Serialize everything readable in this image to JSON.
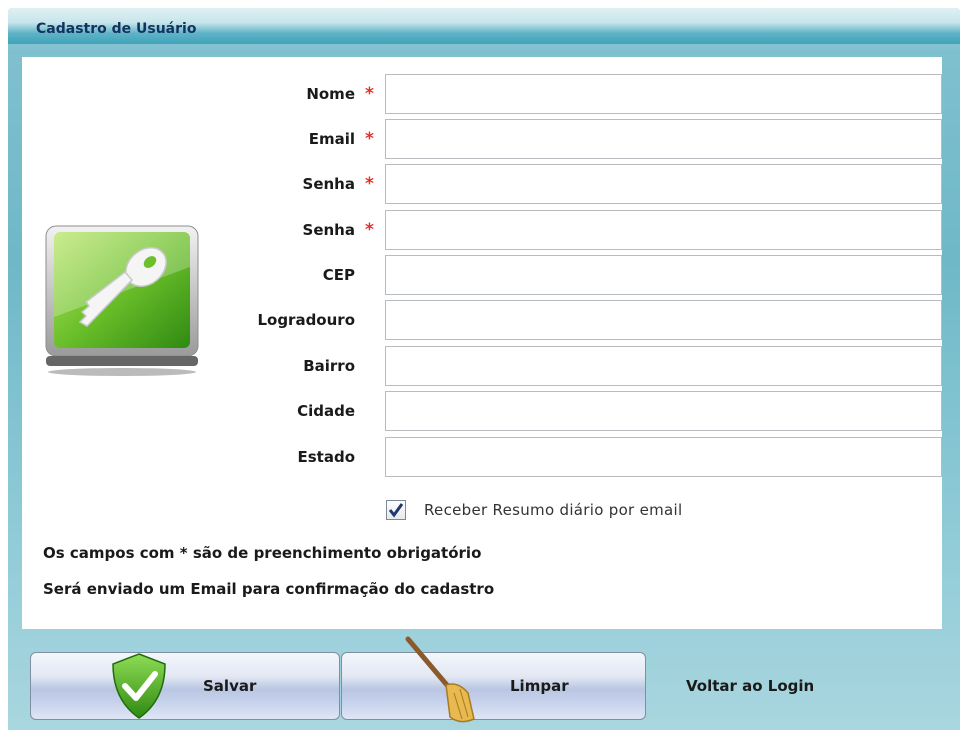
{
  "window": {
    "title": "Cadastro de Usuário"
  },
  "form": {
    "fields": [
      {
        "label": "Nome",
        "required": true,
        "value": ""
      },
      {
        "label": "Email",
        "required": true,
        "value": ""
      },
      {
        "label": "Senha",
        "required": true,
        "value": ""
      },
      {
        "label": "Senha",
        "required": true,
        "value": ""
      },
      {
        "label": "CEP",
        "required": false,
        "value": ""
      },
      {
        "label": "Logradouro",
        "required": false,
        "value": ""
      },
      {
        "label": "Bairro",
        "required": false,
        "value": ""
      },
      {
        "label": "Cidade",
        "required": false,
        "value": ""
      },
      {
        "label": "Estado",
        "required": false,
        "value": ""
      }
    ],
    "required_marker": "*",
    "checkbox": {
      "label": "Receber Resumo diário por email",
      "checked": true
    },
    "notes": [
      "Os campos com * são de preenchimento obrigatório",
      "Será enviado um Email para confirmação do cadastro"
    ]
  },
  "buttons": {
    "save": {
      "label": "Salvar",
      "icon": "shield-check-icon"
    },
    "clear": {
      "label": "Limpar",
      "icon": "broom-icon"
    }
  },
  "back_link": "Voltar ao Login",
  "icons": {
    "key": "key-icon"
  },
  "colors": {
    "required": "#e03030",
    "title": "#14325f"
  }
}
